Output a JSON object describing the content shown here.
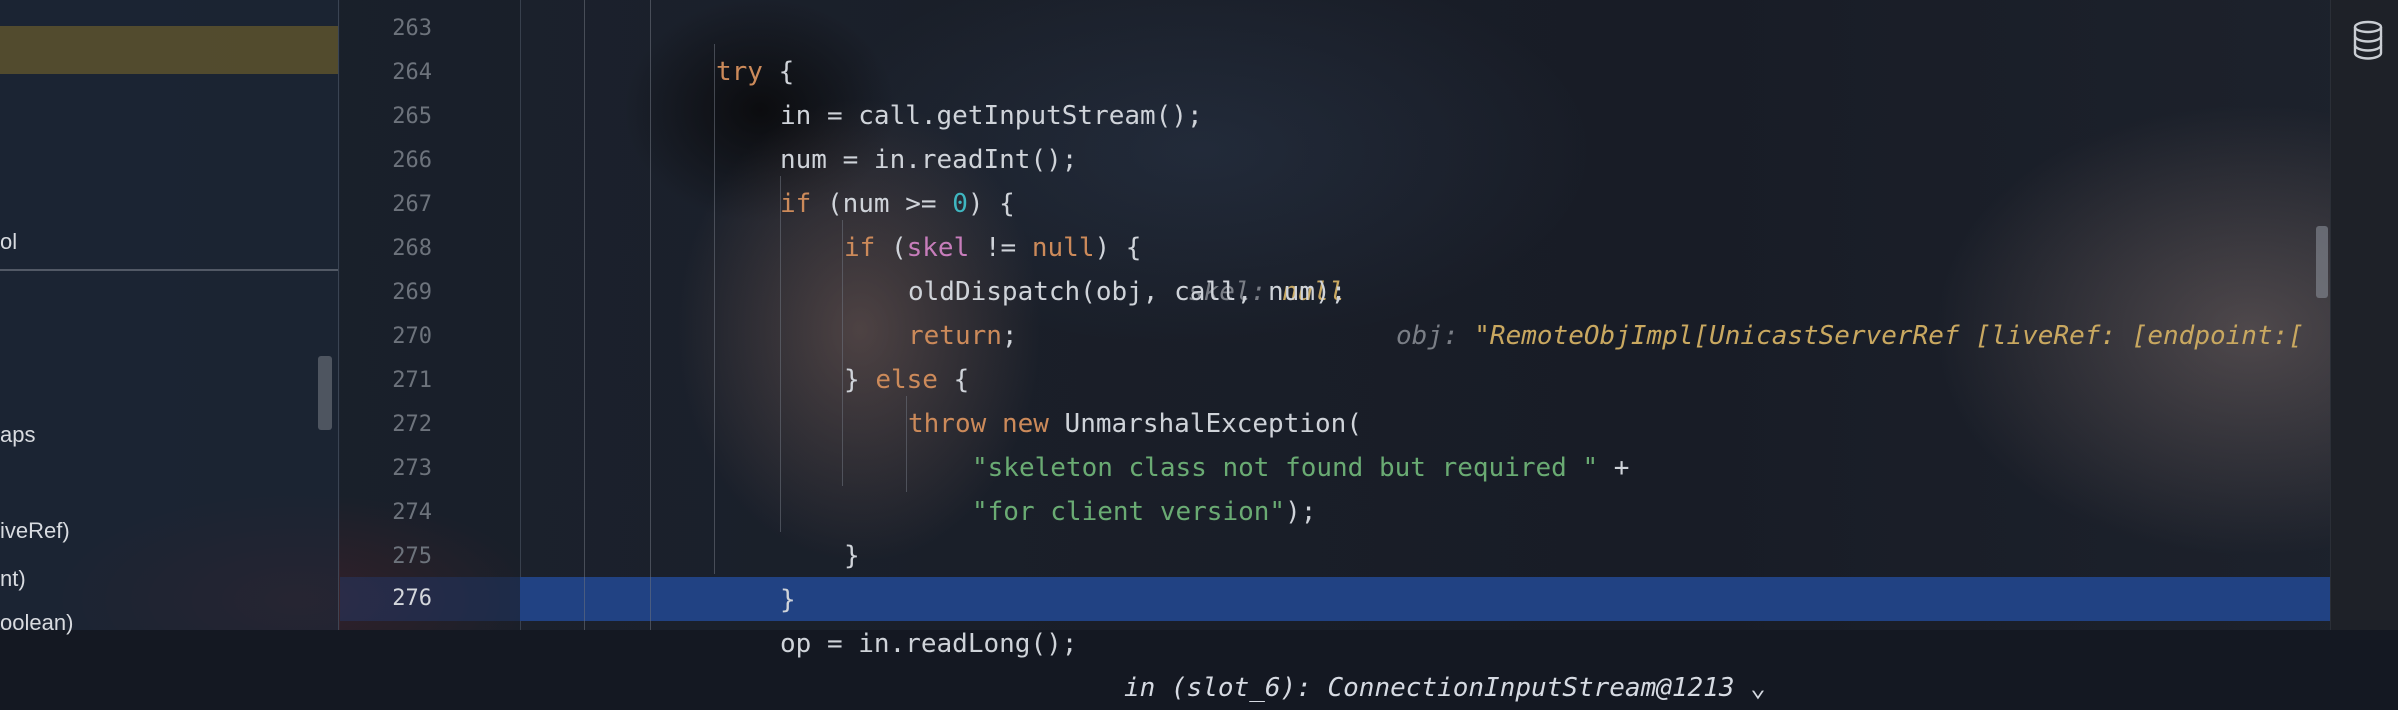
{
  "left_panel": {
    "items": [
      {
        "text": "ol"
      },
      {
        "text": "aps"
      },
      {
        "text": "iveRef)"
      },
      {
        "text": "nt)"
      },
      {
        "text": "oolean)"
      }
    ]
  },
  "editor": {
    "line_numbers": [
      "263",
      "264",
      "265",
      "266",
      "267",
      "268",
      "269",
      "270",
      "271",
      "272",
      "273",
      "274",
      "275",
      "276"
    ],
    "current_line": "276",
    "lines": {
      "l263": {
        "kw_try": "try",
        "rest": " {"
      },
      "l264": {
        "code": "in = call.getInputStream();"
      },
      "l265": {
        "code": "num = in.readInt();"
      },
      "l266": {
        "kw_if": "if",
        "open": " (num >= ",
        "num": "0",
        "close": ") {"
      },
      "l267": {
        "kw_if": "if",
        "open": " (",
        "field": "skel",
        "mid": " != ",
        "kw_null": "null",
        "close": ") {",
        "hint_name": "skel:",
        "hint_value": "null"
      },
      "l268": {
        "code": "oldDispatch(obj, call, num);",
        "hint_name": "obj:",
        "hint_value": "\"RemoteObjImpl[UnicastServerRef [liveRef: [endpoint:["
      },
      "l269": {
        "kw_return": "return",
        "rest": ";"
      },
      "l270": {
        "open": "} ",
        "kw_else": "else",
        "close": " {"
      },
      "l271": {
        "kw_throw": "throw",
        "sp": " ",
        "kw_new": "new",
        "rest": " UnmarshalException("
      },
      "l272": {
        "str": "\"skeleton class not found but required \"",
        "rest": " +"
      },
      "l273": {
        "str": "\"for client version\"",
        "rest": ");"
      },
      "l274": {
        "code": "}"
      },
      "l275": {
        "code": "}"
      },
      "l276": {
        "code": "op = in.readLong();",
        "hint_name": "in (slot_6):",
        "hint_value": "ConnectionInputStream@1213",
        "expand": "⌄"
      }
    }
  },
  "right_bar": {
    "icon": "database-icon"
  },
  "colors": {
    "keyword": "#cc8a5a",
    "number": "#3fb6c0",
    "field": "#c77dbb",
    "string": "#6aab73",
    "hint_value": "#c9a860",
    "current_line": "#214283"
  }
}
